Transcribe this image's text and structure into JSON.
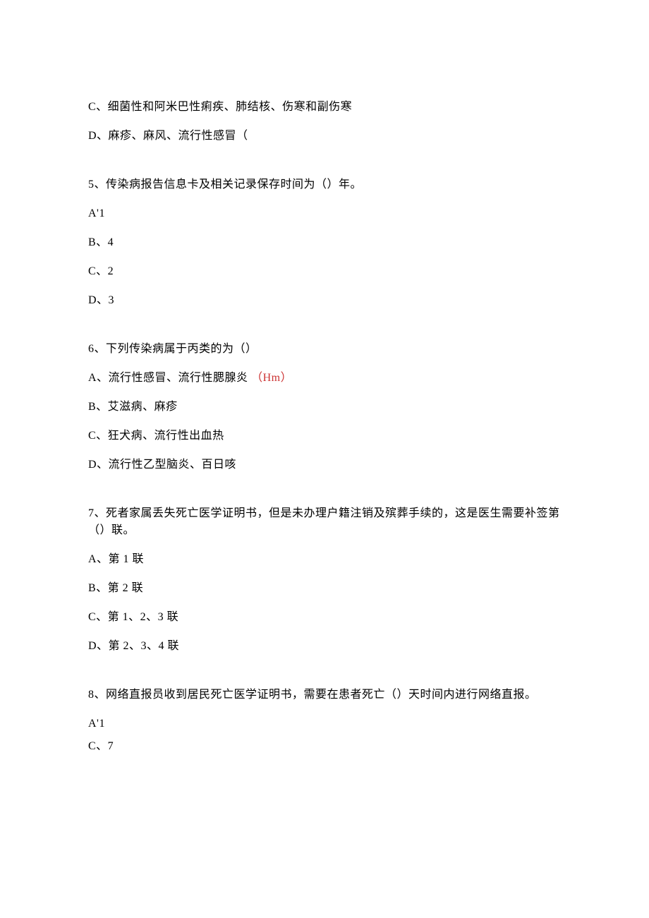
{
  "lines": {
    "l1": "C、细菌性和阿米巴性痢疾、肺结核、伤寒和副伤寒",
    "l2": "D、麻疹、麻风、流行性感冒（",
    "q5": "5、传染病报告信息卡及相关记录保存时间为（）年。",
    "q5a": "A'1",
    "q5b": "B、4",
    "q5c": "C、2",
    "q5d": "D、3",
    "q6": "6、下列传染病属于丙类的为（）",
    "q6a_prefix": "A、流行性感冒、流行性腮腺炎",
    "q6a_red": "（Hm）",
    "q6b": "B、艾滋病、麻疹",
    "q6c": "C、狂犬病、流行性出血热",
    "q6d": "D、流行性乙型脑炎、百日咳",
    "q7": "7、死者家属丢失死亡医学证明书，但是未办理户籍注销及殡葬手续的，这是医生需要补签第（）联。",
    "q7a": "A、第 1 联",
    "q7b": "B、第 2 联",
    "q7c": "C、第 1、2、3 联",
    "q7d": "D、第 2、3、4 联",
    "q8": "8、网络直报员收到居民死亡医学证明书，需要在患者死亡（）天时间内进行网络直报。",
    "q8a": "A'1",
    "q8c": "C、7"
  }
}
